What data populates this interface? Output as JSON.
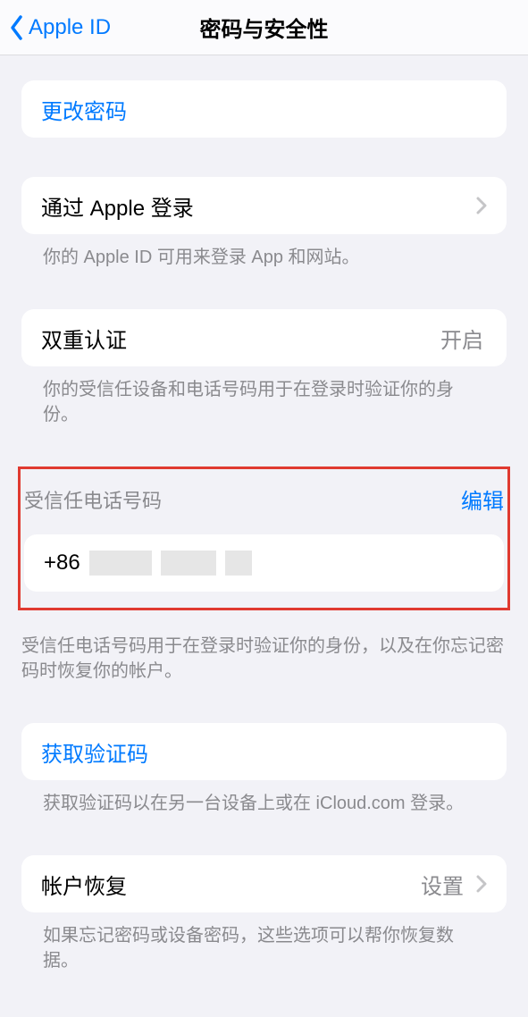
{
  "navbar": {
    "back_label": "Apple ID",
    "title": "密码与安全性"
  },
  "change_password": {
    "label": "更改密码"
  },
  "sign_in_with_apple": {
    "label": "通过 Apple 登录",
    "footer": "你的 Apple ID 可用来登录 App 和网站。"
  },
  "two_factor": {
    "label": "双重认证",
    "status": "开启",
    "footer": "你的受信任设备和电话号码用于在登录时验证你的身份。"
  },
  "trusted_phone": {
    "header": "受信任电话号码",
    "edit": "编辑",
    "value_prefix": "+86",
    "footer": "受信任电话号码用于在登录时验证你的身份，以及在你忘记密码时恢复你的帐户。"
  },
  "get_code": {
    "label": "获取验证码",
    "footer": "获取验证码以在另一台设备上或在 iCloud.com 登录。"
  },
  "account_recovery": {
    "label": "帐户恢复",
    "detail": "设置",
    "footer": "如果忘记密码或设备密码，这些选项可以帮你恢复数据。"
  }
}
